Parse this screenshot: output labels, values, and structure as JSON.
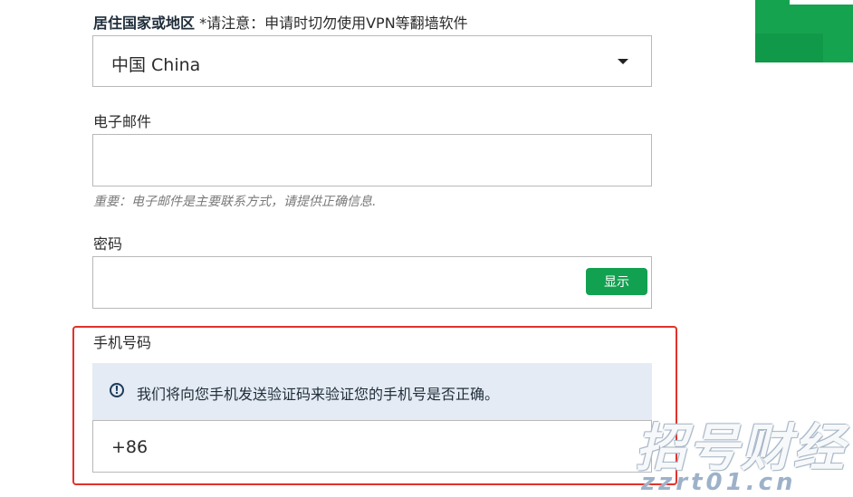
{
  "country": {
    "label_bold": "居住国家或地区",
    "label_note": "*请注意：申请时切勿使用VPN等翻墙软件",
    "selected_value": "中国 China"
  },
  "email": {
    "label": "电子邮件",
    "value": "",
    "hint": "重要：电子邮件是主要联系方式，请提供正确信息."
  },
  "password": {
    "label": "密码",
    "value": "",
    "show_button": "显示"
  },
  "phone": {
    "label": "手机号码",
    "info_text": "我们将向您手机发送验证码来验证您的手机号是否正确。",
    "value": "+86"
  },
  "watermark": {
    "main": "招号财经",
    "sub": "zzrt01.cn"
  },
  "colors": {
    "accent_green": "#12a150",
    "highlight_red": "#e0332b",
    "info_background": "#e4ebf4"
  }
}
